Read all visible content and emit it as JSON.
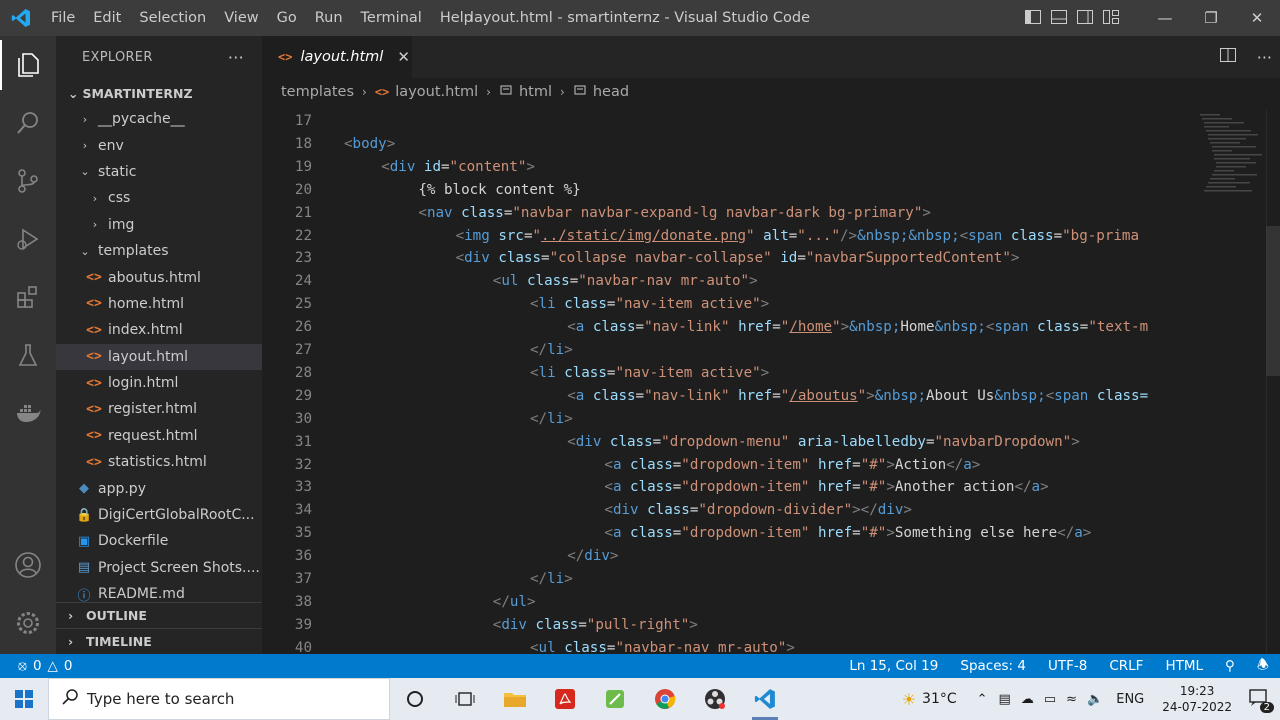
{
  "titlebar": {
    "menu": [
      "File",
      "Edit",
      "Selection",
      "View",
      "Go",
      "Run",
      "Terminal",
      "Help"
    ],
    "title": "layout.html - smartinternz - Visual Studio Code"
  },
  "activity_bar": [
    "explorer-icon",
    "search-icon",
    "source-control-icon",
    "run-debug-icon",
    "extensions-icon",
    "testing-icon",
    "docker-icon",
    "account-icon",
    "settings-gear-icon"
  ],
  "sidebar": {
    "header": "EXPLORER",
    "folder": "SMARTINTERNZ",
    "items": [
      {
        "label": "__pycache__",
        "kind": "folder",
        "open": false,
        "depth": 0
      },
      {
        "label": "env",
        "kind": "folder",
        "open": false,
        "depth": 0
      },
      {
        "label": "static",
        "kind": "folder",
        "open": true,
        "depth": 0
      },
      {
        "label": "css",
        "kind": "folder",
        "open": false,
        "depth": 1
      },
      {
        "label": "img",
        "kind": "folder",
        "open": false,
        "depth": 1
      },
      {
        "label": "templates",
        "kind": "folder",
        "open": true,
        "depth": 0
      },
      {
        "label": "aboutus.html",
        "kind": "html",
        "depth": 1
      },
      {
        "label": "home.html",
        "kind": "html",
        "depth": 1
      },
      {
        "label": "index.html",
        "kind": "html",
        "depth": 1
      },
      {
        "label": "layout.html",
        "kind": "html",
        "depth": 1,
        "selected": true
      },
      {
        "label": "login.html",
        "kind": "html",
        "depth": 1
      },
      {
        "label": "register.html",
        "kind": "html",
        "depth": 1
      },
      {
        "label": "request.html",
        "kind": "html",
        "depth": 1
      },
      {
        "label": "statistics.html",
        "kind": "html",
        "depth": 1
      },
      {
        "label": "app.py",
        "kind": "python",
        "depth": 0
      },
      {
        "label": "DigiCertGlobalRootC...",
        "kind": "cert",
        "depth": 0
      },
      {
        "label": "Dockerfile",
        "kind": "docker",
        "depth": 0
      },
      {
        "label": "Project Screen Shots....",
        "kind": "doc",
        "depth": 0
      },
      {
        "label": "README.md",
        "kind": "info",
        "depth": 0
      }
    ],
    "outline": "OUTLINE",
    "timeline": "TIMELINE"
  },
  "editor": {
    "tab_label": "layout.html",
    "breadcrumb": [
      "templates",
      "layout.html",
      "html",
      "head"
    ],
    "lines": [
      {
        "n": "17",
        "indent": 0,
        "tokens": []
      },
      {
        "n": "18",
        "indent": 0,
        "tokens": [
          [
            "t",
            "<"
          ],
          [
            "n",
            "body"
          ],
          [
            "t",
            ">"
          ]
        ]
      },
      {
        "n": "19",
        "indent": 1,
        "tokens": [
          [
            "t",
            "<"
          ],
          [
            "n",
            "div"
          ],
          [
            "x",
            " "
          ],
          [
            "a",
            "id"
          ],
          [
            "x",
            "="
          ],
          [
            "s",
            "\"content\""
          ],
          [
            "t",
            ">"
          ]
        ]
      },
      {
        "n": "20",
        "indent": 2,
        "tokens": [
          [
            "x",
            "{% block content %}"
          ]
        ]
      },
      {
        "n": "21",
        "indent": 2,
        "tokens": [
          [
            "t",
            "<"
          ],
          [
            "n",
            "nav"
          ],
          [
            "x",
            " "
          ],
          [
            "a",
            "class"
          ],
          [
            "x",
            "="
          ],
          [
            "s",
            "\"navbar navbar-expand-lg navbar-dark bg-primary\""
          ],
          [
            "t",
            ">"
          ]
        ]
      },
      {
        "n": "22",
        "indent": 3,
        "tokens": [
          [
            "t",
            "<"
          ],
          [
            "n",
            "img"
          ],
          [
            "x",
            " "
          ],
          [
            "a",
            "src"
          ],
          [
            "x",
            "="
          ],
          [
            "s",
            "\""
          ],
          [
            "su",
            "../static/img/donate.png"
          ],
          [
            "s",
            "\""
          ],
          [
            "x",
            " "
          ],
          [
            "a",
            "alt"
          ],
          [
            "x",
            "="
          ],
          [
            "s",
            "\"...\""
          ],
          [
            "t",
            "/>"
          ],
          [
            "e",
            "&nbsp;&nbsp;"
          ],
          [
            "t",
            "<"
          ],
          [
            "n",
            "span"
          ],
          [
            "x",
            " "
          ],
          [
            "a",
            "class"
          ],
          [
            "x",
            "="
          ],
          [
            "s",
            "\"bg-prima"
          ]
        ]
      },
      {
        "n": "23",
        "indent": 3,
        "tokens": [
          [
            "t",
            "<"
          ],
          [
            "n",
            "div"
          ],
          [
            "x",
            " "
          ],
          [
            "a",
            "class"
          ],
          [
            "x",
            "="
          ],
          [
            "s",
            "\"collapse navbar-collapse\""
          ],
          [
            "x",
            " "
          ],
          [
            "a",
            "id"
          ],
          [
            "x",
            "="
          ],
          [
            "s",
            "\"navbarSupportedContent\""
          ],
          [
            "t",
            ">"
          ]
        ]
      },
      {
        "n": "24",
        "indent": 4,
        "tokens": [
          [
            "t",
            "<"
          ],
          [
            "n",
            "ul"
          ],
          [
            "x",
            " "
          ],
          [
            "a",
            "class"
          ],
          [
            "x",
            "="
          ],
          [
            "s",
            "\"navbar-nav mr-auto\""
          ],
          [
            "t",
            ">"
          ]
        ]
      },
      {
        "n": "25",
        "indent": 5,
        "tokens": [
          [
            "t",
            "<"
          ],
          [
            "n",
            "li"
          ],
          [
            "x",
            " "
          ],
          [
            "a",
            "class"
          ],
          [
            "x",
            "="
          ],
          [
            "s",
            "\"nav-item active\""
          ],
          [
            "t",
            ">"
          ]
        ]
      },
      {
        "n": "26",
        "indent": 6,
        "tokens": [
          [
            "t",
            "<"
          ],
          [
            "n",
            "a"
          ],
          [
            "x",
            " "
          ],
          [
            "a",
            "class"
          ],
          [
            "x",
            "="
          ],
          [
            "s",
            "\"nav-link\""
          ],
          [
            "x",
            " "
          ],
          [
            "a",
            "href"
          ],
          [
            "x",
            "="
          ],
          [
            "s",
            "\""
          ],
          [
            "su",
            "/home"
          ],
          [
            "s",
            "\""
          ],
          [
            "t",
            ">"
          ],
          [
            "e",
            "&nbsp;"
          ],
          [
            "x",
            "Home"
          ],
          [
            "e",
            "&nbsp;"
          ],
          [
            "t",
            "<"
          ],
          [
            "n",
            "span"
          ],
          [
            "x",
            " "
          ],
          [
            "a",
            "class"
          ],
          [
            "x",
            "="
          ],
          [
            "s",
            "\"text-m"
          ]
        ]
      },
      {
        "n": "27",
        "indent": 5,
        "tokens": [
          [
            "t",
            "</"
          ],
          [
            "n",
            "li"
          ],
          [
            "t",
            ">"
          ]
        ]
      },
      {
        "n": "28",
        "indent": 5,
        "tokens": [
          [
            "t",
            "<"
          ],
          [
            "n",
            "li"
          ],
          [
            "x",
            " "
          ],
          [
            "a",
            "class"
          ],
          [
            "x",
            "="
          ],
          [
            "s",
            "\"nav-item active\""
          ],
          [
            "t",
            ">"
          ]
        ]
      },
      {
        "n": "29",
        "indent": 6,
        "tokens": [
          [
            "t",
            "<"
          ],
          [
            "n",
            "a"
          ],
          [
            "x",
            " "
          ],
          [
            "a",
            "class"
          ],
          [
            "x",
            "="
          ],
          [
            "s",
            "\"nav-link\""
          ],
          [
            "x",
            " "
          ],
          [
            "a",
            "href"
          ],
          [
            "x",
            "="
          ],
          [
            "s",
            "\""
          ],
          [
            "su",
            "/aboutus"
          ],
          [
            "s",
            "\""
          ],
          [
            "t",
            ">"
          ],
          [
            "e",
            "&nbsp;"
          ],
          [
            "x",
            "About Us"
          ],
          [
            "e",
            "&nbsp;"
          ],
          [
            "t",
            "<"
          ],
          [
            "n",
            "span"
          ],
          [
            "x",
            " "
          ],
          [
            "a",
            "class="
          ]
        ]
      },
      {
        "n": "30",
        "indent": 5,
        "tokens": [
          [
            "t",
            "</"
          ],
          [
            "n",
            "li"
          ],
          [
            "t",
            ">"
          ]
        ]
      },
      {
        "n": "31",
        "indent": 6,
        "tokens": [
          [
            "t",
            "<"
          ],
          [
            "n",
            "div"
          ],
          [
            "x",
            " "
          ],
          [
            "a",
            "class"
          ],
          [
            "x",
            "="
          ],
          [
            "s",
            "\"dropdown-menu\""
          ],
          [
            "x",
            " "
          ],
          [
            "a",
            "aria-labelledby"
          ],
          [
            "x",
            "="
          ],
          [
            "s",
            "\"navbarDropdown\""
          ],
          [
            "t",
            ">"
          ]
        ]
      },
      {
        "n": "32",
        "indent": 7,
        "tokens": [
          [
            "t",
            "<"
          ],
          [
            "n",
            "a"
          ],
          [
            "x",
            " "
          ],
          [
            "a",
            "class"
          ],
          [
            "x",
            "="
          ],
          [
            "s",
            "\"dropdown-item\""
          ],
          [
            "x",
            " "
          ],
          [
            "a",
            "href"
          ],
          [
            "x",
            "="
          ],
          [
            "s",
            "\"#\""
          ],
          [
            "t",
            ">"
          ],
          [
            "x",
            "Action"
          ],
          [
            "t",
            "</"
          ],
          [
            "n",
            "a"
          ],
          [
            "t",
            ">"
          ]
        ]
      },
      {
        "n": "33",
        "indent": 7,
        "tokens": [
          [
            "t",
            "<"
          ],
          [
            "n",
            "a"
          ],
          [
            "x",
            " "
          ],
          [
            "a",
            "class"
          ],
          [
            "x",
            "="
          ],
          [
            "s",
            "\"dropdown-item\""
          ],
          [
            "x",
            " "
          ],
          [
            "a",
            "href"
          ],
          [
            "x",
            "="
          ],
          [
            "s",
            "\"#\""
          ],
          [
            "t",
            ">"
          ],
          [
            "x",
            "Another action"
          ],
          [
            "t",
            "</"
          ],
          [
            "n",
            "a"
          ],
          [
            "t",
            ">"
          ]
        ]
      },
      {
        "n": "34",
        "indent": 7,
        "tokens": [
          [
            "t",
            "<"
          ],
          [
            "n",
            "div"
          ],
          [
            "x",
            " "
          ],
          [
            "a",
            "class"
          ],
          [
            "x",
            "="
          ],
          [
            "s",
            "\"dropdown-divider\""
          ],
          [
            "t",
            "></"
          ],
          [
            "n",
            "div"
          ],
          [
            "t",
            ">"
          ]
        ]
      },
      {
        "n": "35",
        "indent": 7,
        "tokens": [
          [
            "t",
            "<"
          ],
          [
            "n",
            "a"
          ],
          [
            "x",
            " "
          ],
          [
            "a",
            "class"
          ],
          [
            "x",
            "="
          ],
          [
            "s",
            "\"dropdown-item\""
          ],
          [
            "x",
            " "
          ],
          [
            "a",
            "href"
          ],
          [
            "x",
            "="
          ],
          [
            "s",
            "\"#\""
          ],
          [
            "t",
            ">"
          ],
          [
            "x",
            "Something else here"
          ],
          [
            "t",
            "</"
          ],
          [
            "n",
            "a"
          ],
          [
            "t",
            ">"
          ]
        ]
      },
      {
        "n": "36",
        "indent": 6,
        "tokens": [
          [
            "t",
            "</"
          ],
          [
            "n",
            "div"
          ],
          [
            "t",
            ">"
          ]
        ]
      },
      {
        "n": "37",
        "indent": 5,
        "tokens": [
          [
            "t",
            "</"
          ],
          [
            "n",
            "li"
          ],
          [
            "t",
            ">"
          ]
        ]
      },
      {
        "n": "38",
        "indent": 4,
        "tokens": [
          [
            "t",
            "</"
          ],
          [
            "n",
            "ul"
          ],
          [
            "t",
            ">"
          ]
        ]
      },
      {
        "n": "39",
        "indent": 4,
        "tokens": [
          [
            "t",
            "<"
          ],
          [
            "n",
            "div"
          ],
          [
            "x",
            " "
          ],
          [
            "a",
            "class"
          ],
          [
            "x",
            "="
          ],
          [
            "s",
            "\"pull-right\""
          ],
          [
            "t",
            ">"
          ]
        ]
      },
      {
        "n": "40",
        "indent": 5,
        "tokens": [
          [
            "t",
            "<"
          ],
          [
            "n",
            "ul"
          ],
          [
            "x",
            " "
          ],
          [
            "a",
            "class"
          ],
          [
            "x",
            "="
          ],
          [
            "s",
            "\"navbar-nav mr-auto\""
          ],
          [
            "t",
            ">"
          ]
        ]
      }
    ]
  },
  "status": {
    "errors": "0",
    "warnings": "0",
    "position": "Ln 15, Col 19",
    "spaces": "Spaces: 4",
    "encoding": "UTF-8",
    "eol": "CRLF",
    "language": "HTML",
    "accent": "#007acc"
  },
  "taskbar": {
    "search_placeholder": "Type here to search",
    "temperature": "31°C",
    "language": "ENG",
    "time": "19:23",
    "date": "24-07-2022",
    "notifications": "2"
  }
}
